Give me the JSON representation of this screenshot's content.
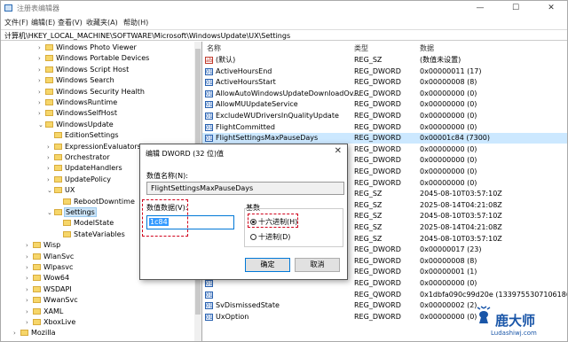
{
  "window": {
    "title": "注册表编辑器",
    "controls": {
      "minimize": "—",
      "maximize": "☐",
      "close": "✕"
    }
  },
  "menu": [
    "文件(F)",
    "编辑(E)",
    "查看(V)",
    "收藏夹(A)",
    "帮助(H)"
  ],
  "address": "计算机\\HKEY_LOCAL_MACHINE\\SOFTWARE\\Microsoft\\WindowsUpdate\\UX\\Settings",
  "tree": [
    {
      "label": "Windows Photo Viewer",
      "expander": "›"
    },
    {
      "label": "Windows Portable Devices",
      "expander": "›"
    },
    {
      "label": "Windows Script Host",
      "expander": "›"
    },
    {
      "label": "Windows Search",
      "expander": "›"
    },
    {
      "label": "Windows Security Health",
      "expander": "›"
    },
    {
      "label": "WindowsRuntime",
      "expander": "›"
    },
    {
      "label": "WindowsSelfHost",
      "expander": "›"
    },
    {
      "label": "WindowsUpdate",
      "expander": "⌄"
    },
    {
      "label": "EditionSettings",
      "expander": ""
    },
    {
      "label": "ExpressionEvaluators",
      "expander": "›"
    },
    {
      "label": "Orchestrator",
      "expander": "›"
    },
    {
      "label": "UpdateHandlers",
      "expander": "›"
    },
    {
      "label": "UpdatePolicy",
      "expander": "›"
    },
    {
      "label": "UX",
      "expander": "⌄"
    },
    {
      "label": "RebootDowntime",
      "expander": ""
    },
    {
      "label": "Settings",
      "expander": "⌄"
    },
    {
      "label": "ModelState",
      "expander": ""
    },
    {
      "label": "StateVariables",
      "expander": ""
    },
    {
      "label": "Wisp",
      "expander": "›"
    },
    {
      "label": "WlanSvc",
      "expander": "›"
    },
    {
      "label": "Wlpasvc",
      "expander": "›"
    },
    {
      "label": "Wow64",
      "expander": "›"
    },
    {
      "label": "WSDAPI",
      "expander": "›"
    },
    {
      "label": "WwanSvc",
      "expander": "›"
    },
    {
      "label": "XAML",
      "expander": "›"
    },
    {
      "label": "XboxLive",
      "expander": "›"
    },
    {
      "label": "Mozilla",
      "expander": "›"
    }
  ],
  "list": {
    "headers": [
      "名称",
      "类型",
      "数据"
    ],
    "rows": [
      {
        "icon": "ab",
        "name": "(默认)",
        "type": "REG_SZ",
        "data": "(数值未设置)"
      },
      {
        "icon": "01",
        "name": "ActiveHoursEnd",
        "type": "REG_DWORD",
        "data": "0x00000011 (17)"
      },
      {
        "icon": "01",
        "name": "ActiveHoursStart",
        "type": "REG_DWORD",
        "data": "0x00000008 (8)"
      },
      {
        "icon": "01",
        "name": "AllowAutoWindowsUpdateDownloadOv...",
        "type": "REG_DWORD",
        "data": "0x00000000 (0)"
      },
      {
        "icon": "01",
        "name": "AllowMUUpdateService",
        "type": "REG_DWORD",
        "data": "0x00000000 (0)"
      },
      {
        "icon": "01",
        "name": "ExcludeWUDriversInQualityUpdate",
        "type": "REG_DWORD",
        "data": "0x00000000 (0)"
      },
      {
        "icon": "01",
        "name": "FlightCommitted",
        "type": "REG_DWORD",
        "data": "0x00000000 (0)"
      },
      {
        "icon": "01",
        "name": "FlightSettingsMaxPauseDays",
        "type": "REG_DWORD",
        "data": "0x00001c84 (7300)"
      },
      {
        "icon": "01",
        "name": "",
        "type": "REG_DWORD",
        "data": "0x00000000 (0)"
      },
      {
        "icon": "01",
        "name": "",
        "type": "REG_DWORD",
        "data": "0x00000000 (0)"
      },
      {
        "icon": "01",
        "name": "",
        "type": "REG_DWORD",
        "data": "0x00000000 (0)"
      },
      {
        "icon": "01",
        "name": "",
        "type": "REG_DWORD",
        "data": "0x00000000 (0)"
      },
      {
        "icon": "ab",
        "name": "",
        "type": "REG_SZ",
        "data": "2045-08-10T03:57:10Z"
      },
      {
        "icon": "ab",
        "name": "",
        "type": "REG_SZ",
        "data": "2025-08-14T04:21:08Z"
      },
      {
        "icon": "ab",
        "name": "",
        "type": "REG_SZ",
        "data": "2045-08-10T03:57:10Z"
      },
      {
        "icon": "ab",
        "name": "",
        "type": "REG_SZ",
        "data": "2025-08-14T04:21:08Z"
      },
      {
        "icon": "ab",
        "name": "",
        "type": "REG_SZ",
        "data": "2045-08-10T03:57:10Z"
      },
      {
        "icon": "01",
        "name": "",
        "type": "REG_DWORD",
        "data": "0x00000017 (23)"
      },
      {
        "icon": "01",
        "name": "",
        "type": "REG_DWORD",
        "data": "0x00000008 (8)"
      },
      {
        "icon": "01",
        "name": "",
        "type": "REG_DWORD",
        "data": "0x00000001 (1)"
      },
      {
        "icon": "01",
        "name": "",
        "type": "REG_DWORD",
        "data": "0x00000000 (0)"
      },
      {
        "icon": "01",
        "name": "",
        "type": "REG_QWORD",
        "data": "0x1dbfa090c99d20e (13397553071061861..."
      },
      {
        "icon": "01",
        "name": "SvDismissedState",
        "type": "REG_DWORD",
        "data": "0x00000002 (2)"
      },
      {
        "icon": "01",
        "name": "UxOption",
        "type": "REG_DWORD",
        "data": "0x00000000 (0)"
      }
    ]
  },
  "dialog": {
    "title": "编辑 DWORD (32 位)值",
    "close": "✕",
    "value_name_label": "数值名称(N):",
    "value_name": "FlightSettingsMaxPauseDays",
    "value_data_label": "数值数据(V):",
    "value_data": "1c84",
    "base_label": "基数",
    "hex_label": "十六进制(H)",
    "dec_label": "十进制(D)",
    "base_selected": "hex",
    "ok": "确定",
    "cancel": "取消"
  },
  "watermark": {
    "name": "鹿大师",
    "url": "Ludashiwj.com"
  },
  "colors": {
    "highlight": "#d0021b",
    "selection": "#cce8ff",
    "accent": "#0078d7"
  }
}
